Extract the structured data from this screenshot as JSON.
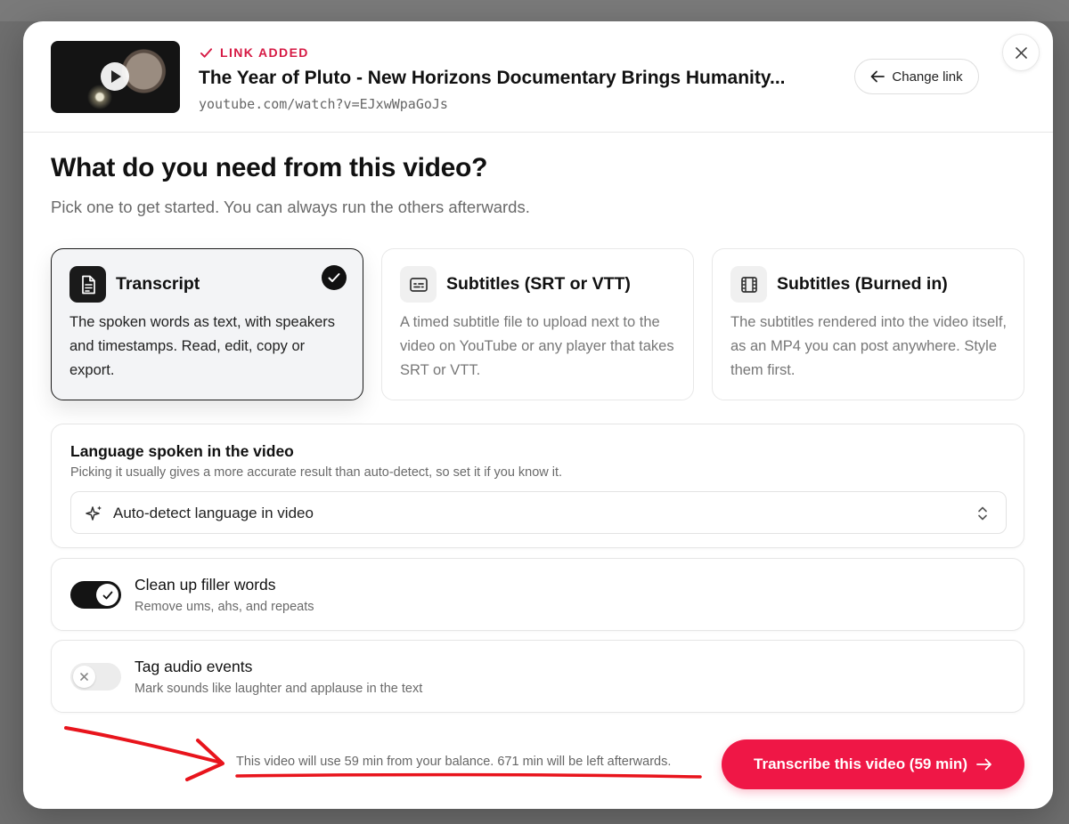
{
  "header": {
    "status_label": "LINK ADDED",
    "video_title": "The Year of Pluto - New Horizons Documentary Brings Humanity...",
    "video_url": "youtube.com/watch?v=EJxwWpaGoJs",
    "change_link_label": "Change link"
  },
  "main": {
    "question": "What do you need from this video?",
    "subtitle": "Pick one to get started. You can always run the others afterwards."
  },
  "options": [
    {
      "title": "Transcript",
      "description": "The spoken words as text, with speakers and timestamps. Read, edit, copy or export.",
      "icon": "document-icon",
      "selected": true
    },
    {
      "title": "Subtitles (SRT or VTT)",
      "description": "A timed subtitle file to upload next to the video on YouTube or any player that takes SRT or VTT.",
      "icon": "captions-icon",
      "selected": false
    },
    {
      "title": "Subtitles (Burned in)",
      "description": "The subtitles rendered into the video itself, as an MP4 you can post anywhere. Style them first.",
      "icon": "film-icon",
      "selected": false
    }
  ],
  "language": {
    "title": "Language spoken in the video",
    "hint": "Picking it usually gives a more accurate result than auto-detect, so set it if you know it.",
    "selected_value": "Auto-detect language in video",
    "icon": "sparkle-icon"
  },
  "toggles": [
    {
      "title": "Clean up filler words",
      "description": "Remove ums, ahs, and repeats",
      "enabled": true
    },
    {
      "title": "Tag audio events",
      "description": "Mark sounds like laughter and applause in the text",
      "enabled": false
    }
  ],
  "footer": {
    "balance_text": "This video will use 59 min from your balance. 671 min will be left afterwards.",
    "cta_label": "Transcribe this video (59 min)"
  },
  "colors": {
    "accent": "#ef1746",
    "status": "#d61a44",
    "annotation": "#e8141c",
    "selected_border": "#1a1a1a"
  }
}
